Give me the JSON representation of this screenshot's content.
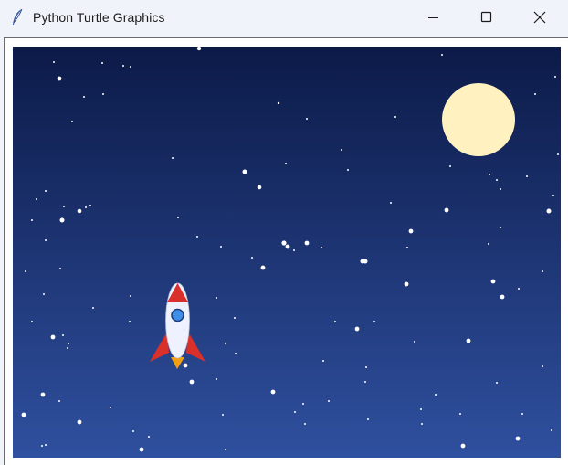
{
  "window": {
    "title": "Python Turtle Graphics",
    "app_icon": "feather-icon",
    "controls": {
      "minimize_icon": "minimize-icon",
      "maximize_icon": "maximize-icon",
      "close_icon": "close-icon"
    }
  },
  "scene": {
    "sky_top_color": "#0c1a48",
    "sky_bottom_color": "#2f509f",
    "star_color": "#ffffff",
    "moon_color": "#fff2c0",
    "rocket_body_color": "#eef2ff",
    "rocket_nose_color": "#d9302b",
    "rocket_fin_color": "#d9302b",
    "rocket_window_color": "#3f8fe8",
    "rocket_flame_color": "#f0a012"
  }
}
